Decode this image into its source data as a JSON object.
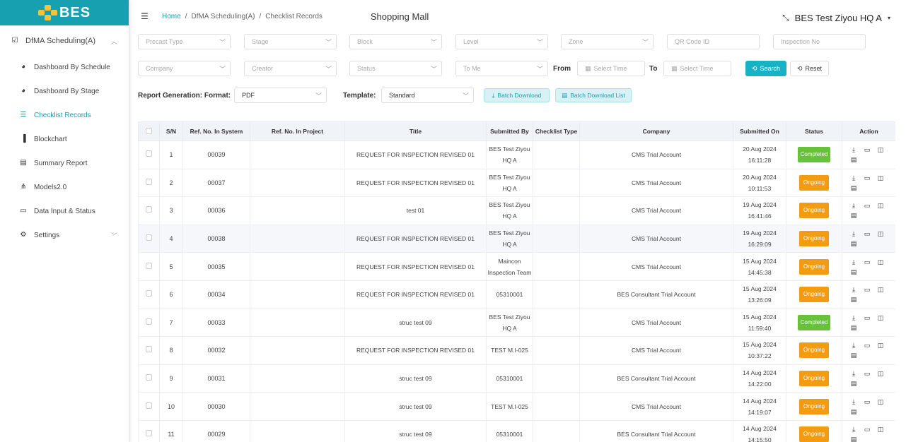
{
  "brand": {
    "name": "BES",
    "accent": "#17a0b0",
    "logo_color": "#f3c33b"
  },
  "sidebar": {
    "group": {
      "label": "DfMA Scheduling(A)",
      "icon": "check-square-icon"
    },
    "items": [
      {
        "label": "Dashboard By Schedule",
        "icon": "dashboard-icon"
      },
      {
        "label": "Dashboard By Stage",
        "icon": "dashboard-icon"
      },
      {
        "label": "Checklist Records",
        "icon": "list-icon",
        "active": true
      },
      {
        "label": "Blockchart",
        "icon": "bar-chart-icon"
      },
      {
        "label": "Summary Report",
        "icon": "report-icon"
      },
      {
        "label": "Models2.0",
        "icon": "hierarchy-icon"
      },
      {
        "label": "Data Input & Status",
        "icon": "monitor-icon"
      },
      {
        "label": "Settings",
        "icon": "gear-icon"
      }
    ]
  },
  "header": {
    "breadcrumb": [
      "Home",
      "/",
      "DfMA Scheduling(A)",
      "/",
      "Checklist Records"
    ],
    "project": "Shopping Mall",
    "user": "BES Test Ziyou HQ A"
  },
  "filters": {
    "precast_type": "Precast Type",
    "stage": "Stage",
    "block": "Block",
    "level": "Level",
    "zone": "Zone",
    "qr_code": "QR Code ID",
    "inspection_no": "Inspection No",
    "company": "Company",
    "creator": "Creator",
    "status": "Status",
    "to_me": "To Me",
    "from_label": "From",
    "to_label": "To",
    "select_time": "Select Time",
    "search": "Search",
    "reset": "Reset"
  },
  "report": {
    "format_label": "Report Generation: Format:",
    "format_value": "PDF",
    "template_label": "Template:",
    "template_value": "Standard",
    "batch_download": "Batch Download",
    "batch_download_list": "Batch Download List"
  },
  "table": {
    "headers": [
      "",
      "S/N",
      "Ref. No. In System",
      "Ref. No. In Project",
      "Title",
      "Submitted By",
      "Checklist Type",
      "Company",
      "Submitted On",
      "Status",
      "Action"
    ],
    "rows": [
      {
        "sn": "1",
        "ref": "00039",
        "proj": "",
        "title": "REQUEST FOR INSPECTION REVISED 01",
        "by1": "BES Test Ziyou",
        "by2": "HQ A",
        "type": "",
        "company": "CMS Trial Account",
        "date": "20 Aug 2024",
        "time": "16:11:28",
        "status": "Completed"
      },
      {
        "sn": "2",
        "ref": "00037",
        "proj": "",
        "title": "REQUEST FOR INSPECTION REVISED 01",
        "by1": "BES Test Ziyou",
        "by2": "HQ A",
        "type": "",
        "company": "CMS Trial Account",
        "date": "20 Aug 2024",
        "time": "10:11:53",
        "status": "Ongoing"
      },
      {
        "sn": "3",
        "ref": "00036",
        "proj": "",
        "title": "test 01",
        "by1": "BES Test Ziyou",
        "by2": "HQ A",
        "type": "",
        "company": "CMS Trial Account",
        "date": "19 Aug 2024",
        "time": "16:41:46",
        "status": "Ongoing"
      },
      {
        "sn": "4",
        "ref": "00038",
        "proj": "",
        "title": "REQUEST FOR INSPECTION REVISED 01",
        "by1": "BES Test Ziyou",
        "by2": "HQ A",
        "type": "",
        "company": "CMS Trial Account",
        "date": "19 Aug 2024",
        "time": "16:29:09",
        "status": "Ongoing"
      },
      {
        "sn": "5",
        "ref": "00035",
        "proj": "",
        "title": "REQUEST FOR INSPECTION REVISED 01",
        "by1": "Maincon",
        "by2": "Inspection Team",
        "type": "",
        "company": "CMS Trial Account",
        "date": "15 Aug 2024",
        "time": "14:45:38",
        "status": "Ongoing"
      },
      {
        "sn": "6",
        "ref": "00034",
        "proj": "",
        "title": "REQUEST FOR INSPECTION REVISED 01",
        "by1": "05310001",
        "by2": "",
        "type": "",
        "company": "BES Consultant Trial Account",
        "date": "15 Aug 2024",
        "time": "13:26:09",
        "status": "Ongoing"
      },
      {
        "sn": "7",
        "ref": "00033",
        "proj": "",
        "title": "struc test 09",
        "by1": "BES Test Ziyou",
        "by2": "HQ A",
        "type": "",
        "company": "CMS Trial Account",
        "date": "15 Aug 2024",
        "time": "11:59:40",
        "status": "Completed"
      },
      {
        "sn": "8",
        "ref": "00032",
        "proj": "",
        "title": "REQUEST FOR INSPECTION REVISED 01",
        "by1": "TEST M.I-025",
        "by2": "",
        "type": "",
        "company": "CMS Trial Account",
        "date": "15 Aug 2024",
        "time": "10:37:22",
        "status": "Ongoing"
      },
      {
        "sn": "9",
        "ref": "00031",
        "proj": "",
        "title": "struc test 09",
        "by1": "05310001",
        "by2": "",
        "type": "",
        "company": "BES Consultant Trial Account",
        "date": "14 Aug 2024",
        "time": "14:22:00",
        "status": "Ongoing"
      },
      {
        "sn": "10",
        "ref": "00030",
        "proj": "",
        "title": "struc test 09",
        "by1": "TEST M.I-025",
        "by2": "",
        "type": "",
        "company": "CMS Trial Account",
        "date": "14 Aug 2024",
        "time": "14:19:07",
        "status": "Ongoing"
      },
      {
        "sn": "11",
        "ref": "00029",
        "proj": "",
        "title": "struc test 09",
        "by1": "05310001",
        "by2": "",
        "type": "",
        "company": "BES Consultant Trial Account",
        "date": "14 Aug 2024",
        "time": "14:15:50",
        "status": "Ongoing"
      }
    ],
    "status_colors": {
      "Completed": "#67c23a",
      "Ongoing": "#f39c12"
    }
  }
}
